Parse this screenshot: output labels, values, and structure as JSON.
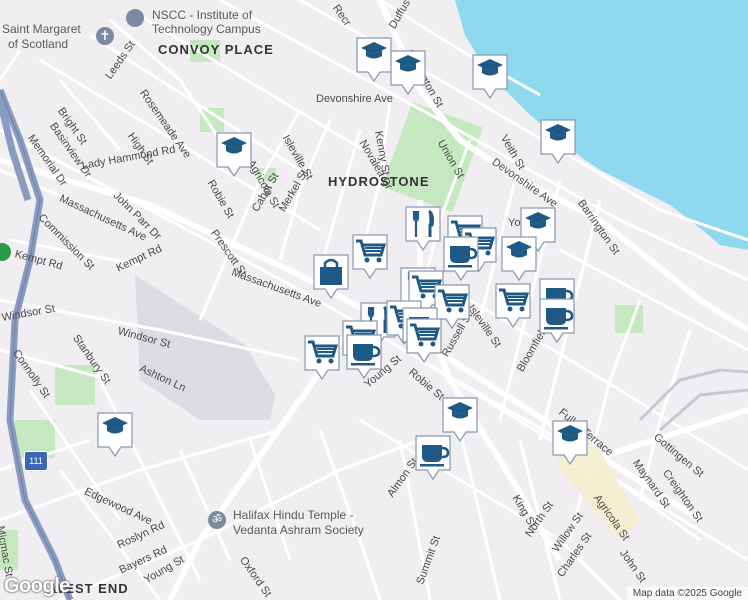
{
  "map": {
    "attribution": "Map data ©2025 Google",
    "logo": "Google"
  },
  "districts": [
    {
      "text": "CONVOY PLACE"
    },
    {
      "text": "HYDROSTONE"
    },
    {
      "text": "WEST END"
    }
  ],
  "poi_labels": [
    {
      "text": "NSCC - Institute of",
      "icon": "school-icon"
    },
    {
      "text": "Technology Campus",
      "icon": ""
    },
    {
      "text": "Saint Margaret",
      "icon": "church-icon"
    },
    {
      "text": "of Scotland",
      "icon": ""
    },
    {
      "text": "Halifax Hindu Temple -",
      "icon": "om-temple-icon"
    },
    {
      "text": "Vedanta Ashram Society",
      "icon": ""
    }
  ],
  "streets": [
    "Duffus St",
    "Barrington St",
    "Leeds St",
    "Rosemeade Ave",
    "Devonshire Ave",
    "Bright St",
    "Memorial Dr",
    "Basinview Dr",
    "High St",
    "Isleville St",
    "Novalea Dr",
    "Kenny St",
    "Union St",
    "Veith St",
    "Lady Hammond Rd",
    "Agricola St",
    "John Parr Dr",
    "Robie St",
    "Massachusetts Ave",
    "Commission St",
    "Prescott St",
    "Cabot St",
    "Merkel St",
    "Devonshire Ave",
    "Barrington St",
    "Kempt Rd",
    "Kempt Rd",
    "Massachusetts Ave",
    "Windsor St",
    "Windsor St",
    "Stanbury St",
    "Connolly St",
    "Ashton Ln",
    "Young St",
    "Russell St",
    "Robie St",
    "Isleville St",
    "Bloomfield St",
    "Fuller Terrace",
    "Gottingen St",
    "Creighton St",
    "Maynard St",
    "Agricola St",
    "King St",
    "Almon St",
    "North St",
    "Willow St",
    "John St",
    "Charles St",
    "Edgewood Ave",
    "Micmac St",
    "Roslyn Rd",
    "Bayers Rd",
    "Oxford St",
    "Young St",
    "Summit St",
    "Recr",
    "Yo",
    "te St"
  ],
  "highway_shield": "111",
  "markers": [
    {
      "icon": "school-icon"
    },
    {
      "icon": "school-icon"
    },
    {
      "icon": "school-icon"
    },
    {
      "icon": "school-icon"
    },
    {
      "icon": "school-icon"
    },
    {
      "icon": "restaurant-icon"
    },
    {
      "icon": "shopping-cart-icon"
    },
    {
      "icon": "shopping-cart-icon"
    },
    {
      "icon": "school-icon"
    },
    {
      "icon": "coffee-icon"
    },
    {
      "icon": "school-icon"
    },
    {
      "icon": "shopping-bag-icon"
    },
    {
      "icon": "shopping-cart-icon"
    },
    {
      "icon": "restaurant-icon"
    },
    {
      "icon": "shopping-cart-icon"
    },
    {
      "icon": "shopping-cart-icon"
    },
    {
      "icon": "coffee-icon"
    },
    {
      "icon": "coffee-icon"
    },
    {
      "icon": "restaurant-icon"
    },
    {
      "icon": "shopping-cart-icon"
    },
    {
      "icon": "shopping-cart-icon"
    },
    {
      "icon": "coffee-icon"
    },
    {
      "icon": "shopping-cart-icon"
    },
    {
      "icon": "coffee-icon"
    },
    {
      "icon": "shopping-cart-icon"
    },
    {
      "icon": "shopping-cart-icon"
    },
    {
      "icon": "school-icon"
    },
    {
      "icon": "school-icon"
    },
    {
      "icon": "coffee-icon"
    },
    {
      "icon": "school-icon"
    }
  ],
  "colors": {
    "water": "#8fd9ee",
    "park": "#c6e8c0",
    "marker": "#1f5a86",
    "marker_bg": "#ffffff",
    "highway": "#8a9bc0",
    "land": "#f1eef2"
  }
}
